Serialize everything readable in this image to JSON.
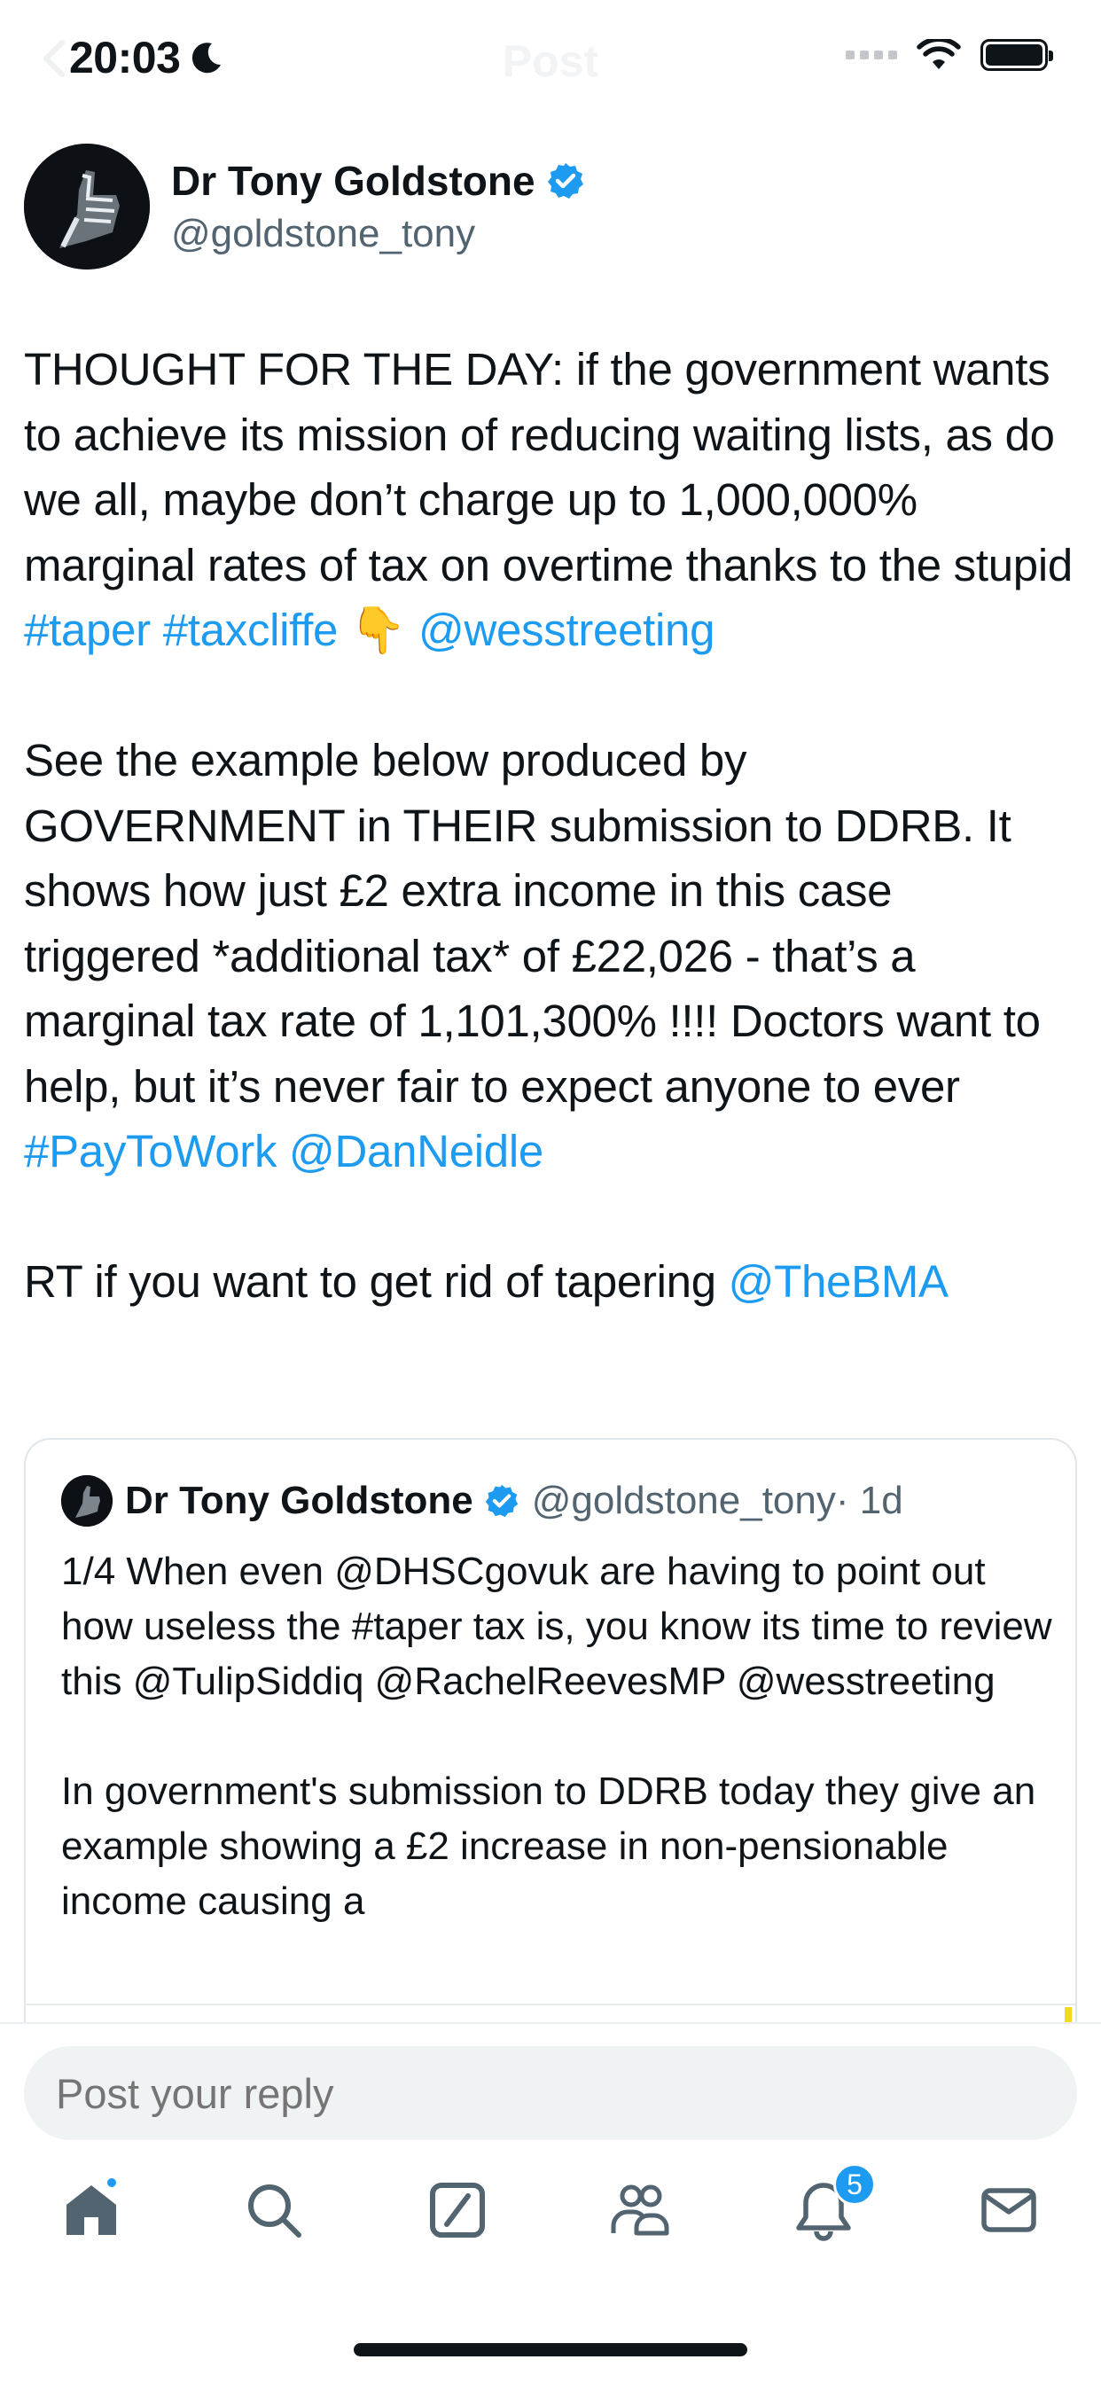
{
  "status_bar": {
    "time": "20:03",
    "focus_icon": "moon-icon",
    "icons": [
      "cellular-signal-icon",
      "wifi-icon",
      "battery-icon"
    ],
    "battery_level": 1.0
  },
  "nav": {
    "back_icon": "chevron-left-icon",
    "title": "Post"
  },
  "post": {
    "author_name": "Dr Tony Goldstone",
    "author_handle": "@goldstone_tony",
    "verified_icon": "verified-badge-icon",
    "p1_text": "THOUGHT FOR THE DAY: if the government wants to achieve its mission of reducing waiting lists, as do we all, maybe don’t charge up to 1,000,000% marginal rates of tax on overtime thanks to the stupid ",
    "p1_tag1": "#taper",
    "p1_tag2": "#taxcliffe",
    "p1_emoji": "👇",
    "p1_mention": "@wesstreeting",
    "p2_text": "See the example below produced by GOVERNMENT in THEIR submission to DDRB. It shows how just £2 extra income in this case triggered *additional tax* of £22,026 - that’s a marginal tax rate of 1,101,300% !!!! Doctors want to help, but it’s never fair to expect anyone to ever ",
    "p2_tag": "#PayToWork",
    "p2_mention": "@DanNeidle",
    "p3_text": "RT if you want to get rid of tapering ",
    "p3_mention": "@TheBMA"
  },
  "quoted_post": {
    "author_name": "Dr Tony Goldstone",
    "author_handle": "@goldstone_tony",
    "time": "· 1d",
    "text_1": "1/4 When even @DHSCgovuk are having to point out how useless the #taper tax is, you know its time to review this @TulipSiddiq @RachelReevesMP @wesstreeting",
    "text_2": "In government's submission to DDRB today they give an example showing a £2 increase in non-pensionable income causing a"
  },
  "reply": {
    "placeholder": "Post your reply"
  },
  "tab_bar": {
    "items": [
      {
        "name": "home",
        "icon": "home-icon",
        "has_dot": true
      },
      {
        "name": "search",
        "icon": "search-icon"
      },
      {
        "name": "grok",
        "icon": "grok-icon"
      },
      {
        "name": "communities",
        "icon": "communities-icon"
      },
      {
        "name": "notifications",
        "icon": "bell-icon",
        "badge": "5"
      },
      {
        "name": "messages",
        "icon": "mail-icon"
      }
    ],
    "notifications_badge": "5"
  },
  "colors": {
    "accent": "#1d9bf0",
    "text": "#0f1419",
    "secondary_text": "#536471"
  }
}
